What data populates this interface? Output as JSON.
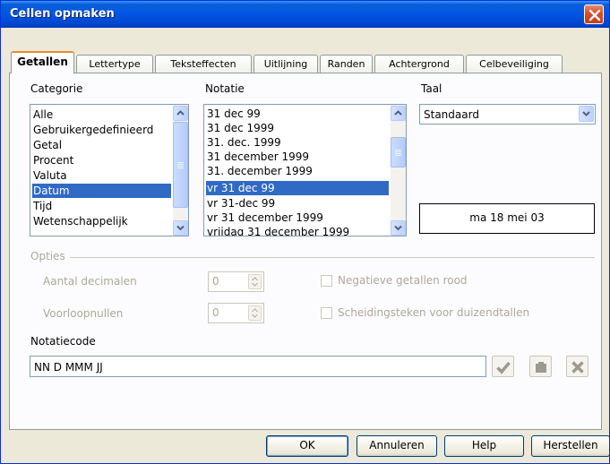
{
  "window": {
    "title": "Cellen opmaken"
  },
  "tabs": [
    {
      "label": "Getallen",
      "active": true
    },
    {
      "label": "Lettertype"
    },
    {
      "label": "Teksteffecten"
    },
    {
      "label": "Uitlijning"
    },
    {
      "label": "Randen"
    },
    {
      "label": "Achtergrond"
    },
    {
      "label": "Celbeveiliging"
    }
  ],
  "category": {
    "label": "Categorie",
    "items": [
      "Alle",
      "Gebruikergedefinieerd",
      "Getal",
      "Procent",
      "Valuta",
      "Datum",
      "Tijd",
      "Wetenschappelijk"
    ],
    "selected": "Datum"
  },
  "format": {
    "label": "Notatie",
    "items": [
      "31 dec 99",
      "31 dec 1999",
      "31. dec. 1999",
      "31 december 1999",
      "31. december 1999",
      "vr 31 dec 99",
      "vr 31-dec 99",
      "vr 31 december 1999",
      "vrijdag 31 december 1999"
    ],
    "selected": "vr 31 dec 99"
  },
  "language": {
    "label": "Taal",
    "value": "Standaard"
  },
  "preview": {
    "text": "ma 18 mei 03"
  },
  "options": {
    "label": "Opties",
    "decimals_label": "Aantal decimalen",
    "decimals_value": "0",
    "leading_zeros_label": "Voorloopnullen",
    "leading_zeros_value": "0",
    "negative_red_label": "Negatieve getallen rood",
    "thousands_sep_label": "Scheidingsteken voor duizendtallen"
  },
  "format_code": {
    "label": "Notatiecode",
    "value": "NN D MMM JJ"
  },
  "buttons": {
    "ok": "OK",
    "cancel": "Annuleren",
    "help": "Help",
    "reset": "Herstellen"
  },
  "colors": {
    "titlebar": "#0055e5",
    "selection": "#316ac5",
    "active_tab_accent": "#e68b2c",
    "dialog_bg": "#ece9d8"
  },
  "icons": [
    "close-icon",
    "checkmark-icon",
    "comment-icon",
    "delete-icon",
    "scroll-up-icon",
    "scroll-down-icon",
    "dropdown-arrow-icon"
  ]
}
